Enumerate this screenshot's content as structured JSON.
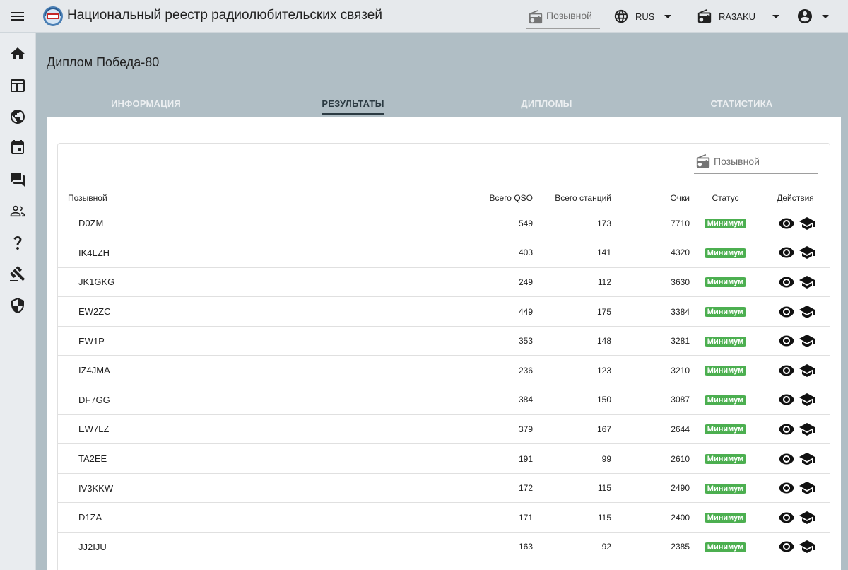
{
  "app": {
    "title": "Национальный реестр радиолюбительских связей"
  },
  "topbar": {
    "search_placeholder": "Позывной",
    "language": "RUS",
    "station": "RA3AKU"
  },
  "sidebar": {
    "items": [
      {
        "icon": "home-icon"
      },
      {
        "icon": "table-icon"
      },
      {
        "icon": "globe-icon"
      },
      {
        "icon": "calendar-icon"
      },
      {
        "icon": "forum-icon"
      },
      {
        "icon": "people-icon"
      },
      {
        "icon": "help-icon"
      },
      {
        "icon": "gavel-icon"
      },
      {
        "icon": "shield-icon"
      }
    ]
  },
  "page": {
    "title": "Диплом Победа-80"
  },
  "tabs": [
    "ИНФОРМАЦИЯ",
    "РЕЗУЛЬТАТЫ",
    "ДИПЛОМЫ",
    "СТАТИСТИКА"
  ],
  "active_tab": 1,
  "results": {
    "search_placeholder": "Позывной",
    "columns": {
      "callsign": "Позывной",
      "qso": "Всего QSO",
      "stations": "Всего станций",
      "points": "Очки",
      "status": "Статус",
      "actions": "Действия"
    },
    "rows": [
      {
        "callsign": "D0ZM",
        "qso": "549",
        "stations": "173",
        "points": "7710",
        "status": "Минимум"
      },
      {
        "callsign": "IK4LZH",
        "qso": "403",
        "stations": "141",
        "points": "4320",
        "status": "Минимум"
      },
      {
        "callsign": "JK1GKG",
        "qso": "249",
        "stations": "112",
        "points": "3630",
        "status": "Минимум"
      },
      {
        "callsign": "EW2ZC",
        "qso": "449",
        "stations": "175",
        "points": "3384",
        "status": "Минимум"
      },
      {
        "callsign": "EW1P",
        "qso": "353",
        "stations": "148",
        "points": "3281",
        "status": "Минимум"
      },
      {
        "callsign": "IZ4JMA",
        "qso": "236",
        "stations": "123",
        "points": "3210",
        "status": "Минимум"
      },
      {
        "callsign": "DF7GG",
        "qso": "384",
        "stations": "150",
        "points": "3087",
        "status": "Минимум"
      },
      {
        "callsign": "EW7LZ",
        "qso": "379",
        "stations": "167",
        "points": "2644",
        "status": "Минимум"
      },
      {
        "callsign": "TA2EE",
        "qso": "191",
        "stations": "99",
        "points": "2610",
        "status": "Минимум"
      },
      {
        "callsign": "IV3KKW",
        "qso": "172",
        "stations": "115",
        "points": "2490",
        "status": "Минимум"
      },
      {
        "callsign": "D1ZA",
        "qso": "171",
        "stations": "115",
        "points": "2400",
        "status": "Минимум"
      },
      {
        "callsign": "JJ2IJU",
        "qso": "163",
        "stations": "92",
        "points": "2385",
        "status": "Минимум"
      }
    ]
  },
  "colors": {
    "background": "#b0bec5",
    "topbar": "#e6e9ec",
    "badge": "#4caf50",
    "active_tab": "#2b3a42"
  }
}
